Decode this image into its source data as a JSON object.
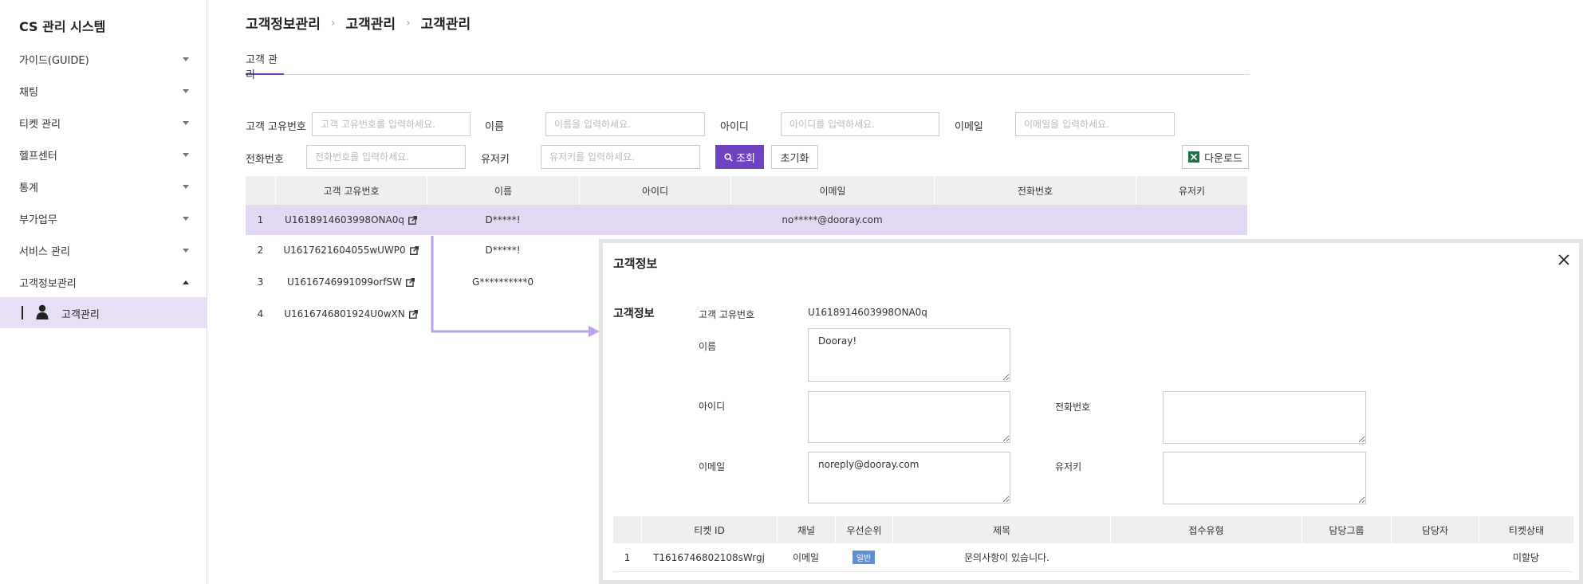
{
  "sidebar": {
    "title": "CS 관리 시스템",
    "items": [
      {
        "label": "가이드(GUIDE)",
        "expanded": false
      },
      {
        "label": "채팅",
        "expanded": false
      },
      {
        "label": "티켓 관리",
        "expanded": false
      },
      {
        "label": "헬프센터",
        "expanded": false
      },
      {
        "label": "통계",
        "expanded": false
      },
      {
        "label": "부가업무",
        "expanded": false
      },
      {
        "label": "서비스 관리",
        "expanded": false
      },
      {
        "label": "고객정보관리",
        "expanded": true
      }
    ],
    "submenu": {
      "label": "고객관리",
      "icon": "person-icon"
    }
  },
  "breadcrumb": [
    "고객정보관리",
    "고객관리",
    "고객관리"
  ],
  "tabs": [
    {
      "label": "고객 관리",
      "active": true
    }
  ],
  "search": {
    "customer_id": {
      "label": "고객 고유번호",
      "placeholder": "고객 고유번호를 입력하세요."
    },
    "name": {
      "label": "이름",
      "placeholder": "이름을 입력하세요."
    },
    "userid": {
      "label": "아이디",
      "placeholder": "아이디를 입력하세요."
    },
    "email": {
      "label": "이메일",
      "placeholder": "이메일을 입력하세요."
    },
    "phone": {
      "label": "전화번호",
      "placeholder": "전화번호를 입력하세요."
    },
    "userkey": {
      "label": "유저키",
      "placeholder": "유저키를 입력하세요."
    },
    "search_button": "조회",
    "reset_button": "초기화",
    "download_button": "다운로드"
  },
  "table": {
    "columns": [
      "고객 고유번호",
      "이름",
      "아이디",
      "이메일",
      "전화번호",
      "유저키"
    ],
    "rows": [
      {
        "no": "1",
        "id": "U1618914603998ONA0q",
        "name": "D*****!",
        "userid": "",
        "email": "no*****@dooray.com",
        "phone": "",
        "userkey": "",
        "selected": true
      },
      {
        "no": "2",
        "id": "U1617621604055wUWP0",
        "name": "D*****!",
        "userid": "",
        "email": "",
        "phone": "",
        "userkey": "",
        "selected": false
      },
      {
        "no": "3",
        "id": "U1616746991099orfSW",
        "name": "G**********0",
        "userid": "",
        "email": "",
        "phone": "",
        "userkey": "",
        "selected": false
      },
      {
        "no": "4",
        "id": "U1616746801924U0wXN",
        "name": "",
        "userid": "",
        "email": "",
        "phone": "",
        "userkey": "",
        "selected": false
      }
    ]
  },
  "modal": {
    "title": "고객정보",
    "section_title": "고객정보",
    "fields": {
      "customer_id_label": "고객 고유번호",
      "customer_id_value": "U1618914603998ONA0q",
      "name_label": "이름",
      "name_value": "Dooray!",
      "userid_label": "아이디",
      "userid_value": "",
      "phone_label": "전화번호",
      "phone_value": "",
      "email_label": "이메일",
      "email_value": "noreply@dooray.com",
      "userkey_label": "유저키",
      "userkey_value": ""
    },
    "tickets": {
      "columns": [
        "티켓 ID",
        "채널",
        "우선순위",
        "제목",
        "접수유형",
        "담당그룹",
        "담당자",
        "티켓상태"
      ],
      "rows": [
        {
          "no": "1",
          "ticket_id": "T1616746802108sWrgj",
          "channel": "이메일",
          "priority": "일반",
          "subject": "문의사항이 있습니다.",
          "intake": "",
          "group": "",
          "assignee": "",
          "status": "미할당"
        }
      ]
    }
  },
  "colors": {
    "accent": "#6f42c1",
    "selected_row": "#e3d9f5",
    "badge": "#5b8fd6",
    "excel": "#1e7145"
  }
}
